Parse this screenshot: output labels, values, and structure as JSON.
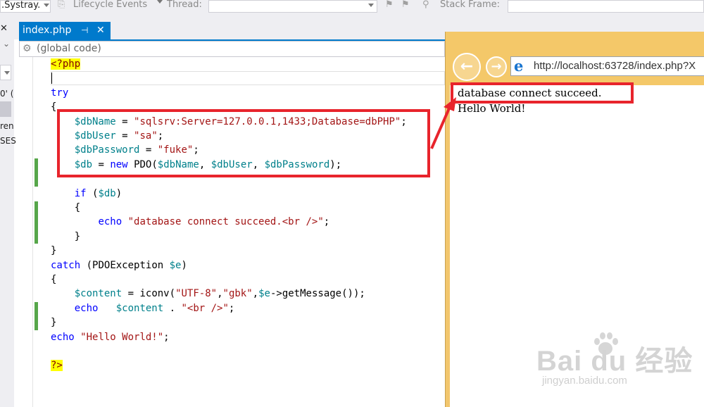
{
  "toolbar": {
    "process_combo": ".Systray.",
    "lifecycle_label": "Lifecycle Events",
    "thread_label": "Thread:",
    "thread_value": "",
    "stackframe_label": "Stack Frame:",
    "stackframe_value": ""
  },
  "left_panel": {
    "close": "✕",
    "fragments": [
      "0' (",
      "ren",
      "SES"
    ]
  },
  "tab": {
    "label": "index.php",
    "pin": "⊣",
    "close": "✕"
  },
  "nav_bar": {
    "scope": "(global code)"
  },
  "code": {
    "lines": [
      "<?php",
      "",
      "try",
      "{",
      "    $dbName = \"sqlsrv:Server=127.0.0.1,1433;Database=dbPHP\";",
      "    $dbUser = \"sa\";",
      "    $dbPassword = \"fuke\";",
      "    $db = new PDO($dbName, $dbUser, $dbPassword);",
      "",
      "    if ($db)",
      "    {",
      "        echo \"database connect succeed.<br />\";",
      "    }",
      "}",
      "catch (PDOException $e)",
      "{",
      "    $content = iconv(\"UTF-8\",\"gbk\",$e->getMessage());",
      "    echo   $content . \"<br />\";",
      "}",
      "echo \"Hello World!\";",
      "",
      "?>"
    ]
  },
  "browser": {
    "address": "http://localhost:63728/index.php?X",
    "output_lines": [
      "database connect succeed.",
      "Hello World!"
    ]
  },
  "watermark": {
    "logo": "Bai du 经验",
    "url": "jingyan.baidu.com"
  },
  "colors": {
    "accent": "#007acc",
    "highlight_red": "#e8242c",
    "browser_frame": "#f2c66d",
    "change_bar": "#57a64a"
  }
}
